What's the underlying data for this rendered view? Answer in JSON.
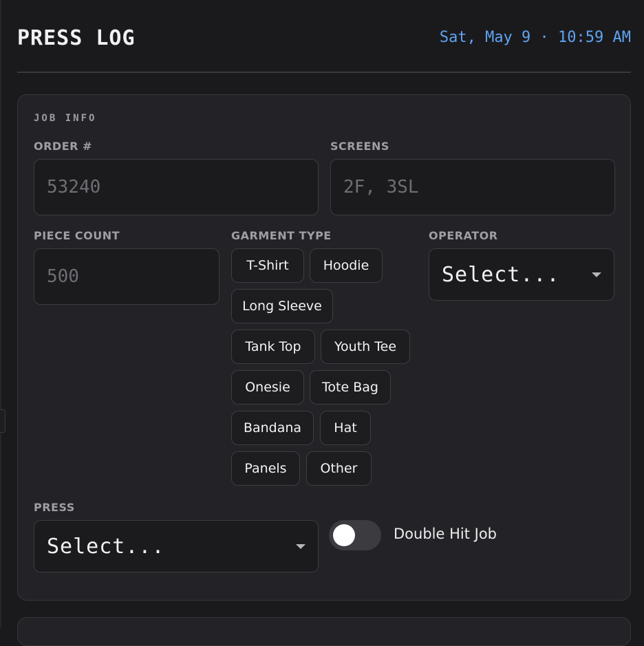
{
  "header": {
    "title": "PRESS LOG",
    "datetime": "Sat, May 9 · 10:59 AM"
  },
  "job_info": {
    "section_label": "JOB INFO",
    "order": {
      "label": "ORDER #",
      "placeholder": "53240"
    },
    "screens": {
      "label": "SCREENS",
      "placeholder": "2F, 3SL"
    },
    "piece_count": {
      "label": "PIECE COUNT",
      "placeholder": "500"
    },
    "garment_type": {
      "label": "GARMENT TYPE",
      "options": [
        "T-Shirt",
        "Hoodie",
        "Long Sleeve",
        "Tank Top",
        "Youth Tee",
        "Onesie",
        "Tote Bag",
        "Bandana",
        "Hat",
        "Panels",
        "Other"
      ]
    },
    "operator": {
      "label": "OPERATOR",
      "value": "Select..."
    },
    "press": {
      "label": "PRESS",
      "value": "Select..."
    },
    "double_hit": {
      "label": "Double Hit Job",
      "on": false
    }
  },
  "icons": {
    "select_caret": "caret-down-icon"
  },
  "colors": {
    "accent": "#5fa3f0",
    "background": "#1a1a1d",
    "card": "#232327"
  }
}
